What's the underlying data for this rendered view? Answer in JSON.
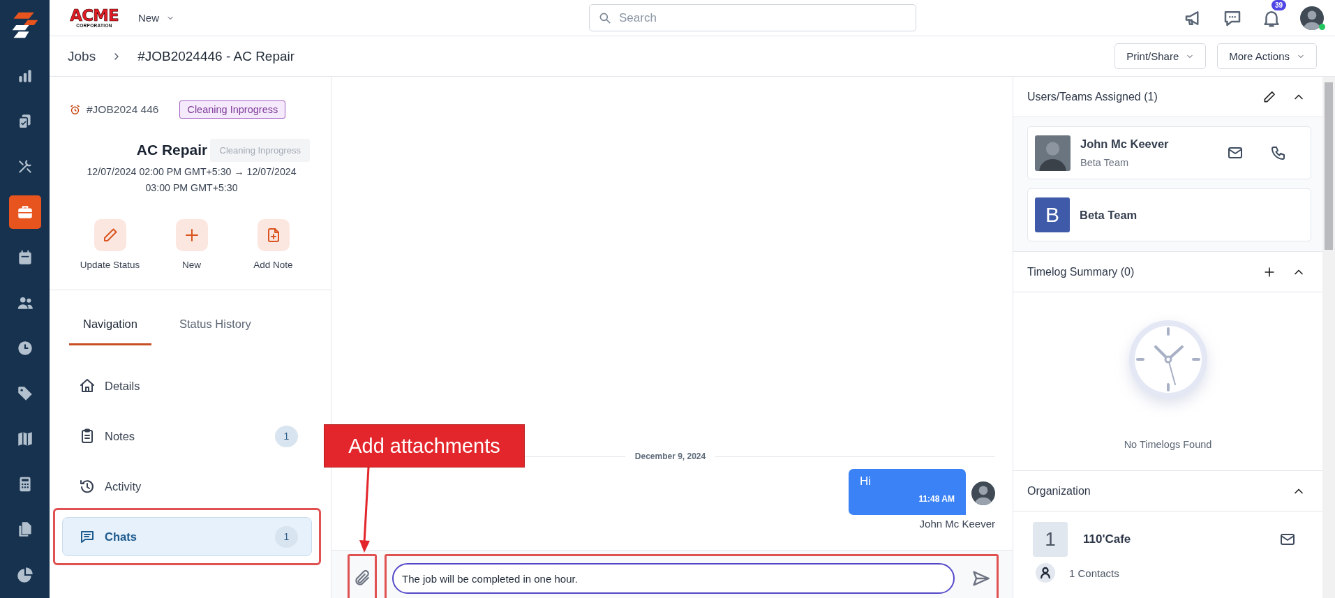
{
  "rail": {
    "items": [
      {
        "selected": false
      },
      {
        "selected": false
      },
      {
        "selected": false
      },
      {
        "selected": true
      },
      {
        "selected": false
      },
      {
        "selected": false
      },
      {
        "selected": false
      },
      {
        "selected": false
      },
      {
        "selected": false
      },
      {
        "selected": false
      },
      {
        "selected": false
      },
      {
        "selected": false
      }
    ]
  },
  "topbar": {
    "logo": {
      "name": "ACME",
      "subtitle": "CORPORATION"
    },
    "new_menu": "New",
    "search": {
      "placeholder": "Search"
    },
    "notifications_badge": "39",
    "user_online": true
  },
  "breadcrumb": {
    "items": [
      "Jobs",
      "#JOB2024446 - AC Repair"
    ],
    "buttons": [
      "Print/Share",
      "More Actions"
    ]
  },
  "job": {
    "id": "#JOB2024 446",
    "status": "Cleaning Inprogress",
    "tooltip": "Cleaning Inprogress",
    "title": "AC Repair",
    "schedule": "12/07/2024 02:00 PM GMT+5:30 → 12/07/2024 03:00 PM GMT+5:30",
    "actions": [
      {
        "label": "Update Status"
      },
      {
        "label": "New"
      },
      {
        "label": "Add Note"
      }
    ]
  },
  "tabs": [
    {
      "label": "Navigation",
      "selected": true
    },
    {
      "label": "Status History",
      "selected": false
    }
  ],
  "nav": [
    {
      "label": "Details",
      "selected": false,
      "highlighted": false
    },
    {
      "label": "Notes",
      "count": "1",
      "selected": false,
      "highlighted": false
    },
    {
      "label": "Activity",
      "selected": false,
      "highlighted": false
    },
    {
      "label": "Chats",
      "count": "1",
      "selected": true,
      "highlighted": true
    }
  ],
  "chat": {
    "date": "December 9, 2024",
    "messages": [
      {
        "text": "Hi",
        "time": "11:48 AM",
        "sender": "John Mc Keever"
      }
    ],
    "composer": {
      "value": "The job will be completed in one hour.",
      "attach_highlighted": true,
      "input_highlighted": true
    }
  },
  "annotations": [
    {
      "kind": "callout",
      "text": "Add attachments"
    }
  ],
  "assigned": {
    "title": "Users/Teams Assigned (1)",
    "expanded": true,
    "members": [
      {
        "kind": "user",
        "name": "John Mc Keever",
        "team": "Beta Team"
      },
      {
        "kind": "team",
        "initial": "B",
        "name": "Beta Team"
      }
    ]
  },
  "timelog": {
    "title": "Timelog Summary (0)",
    "expanded": true,
    "empty_text": "No Timelogs Found"
  },
  "organization": {
    "title": "Organization",
    "expanded": true,
    "initial": "1",
    "name": "110'Cafe",
    "contacts": "1 Contacts"
  }
}
